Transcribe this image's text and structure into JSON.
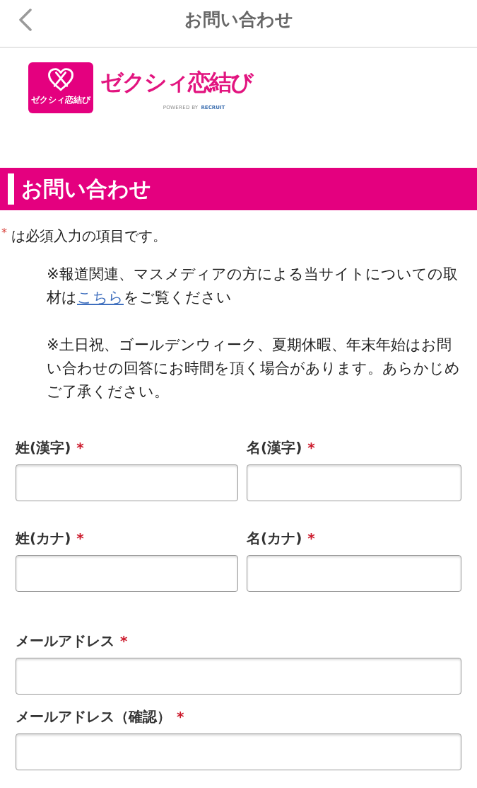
{
  "header": {
    "title": "お問い合わせ"
  },
  "logo": {
    "badge_text": "ゼクシィ恋結び",
    "name": "ゼクシィ恋結び",
    "tagline": "POWERED BY",
    "company": "RECRUIT"
  },
  "section": {
    "title": "お問い合わせ"
  },
  "required_note": {
    "mark": "*",
    "text": "は必須入力の項目です。"
  },
  "notes": [
    {
      "segments": [
        {
          "kind": "text",
          "text": "※報道関連、マスメディアの方による当サイトについての取材は"
        },
        {
          "kind": "link",
          "text": "こちら"
        },
        {
          "kind": "text",
          "text": "をご覧ください"
        }
      ]
    },
    {
      "segments": [
        {
          "kind": "text",
          "text": "※土日祝、ゴールデンウィーク、夏期休暇、年末年始はお問い合わせの回答にお時間を頂く場合があります。あらかじめご了承ください。"
        }
      ]
    }
  ],
  "name_rows": [
    {
      "fields": [
        {
          "label": "姓(漢字)",
          "required_mark": "*"
        },
        {
          "label": "名(漢字)",
          "required_mark": "*"
        }
      ]
    },
    {
      "fields": [
        {
          "label": "姓(カナ)",
          "required_mark": "*"
        },
        {
          "label": "名(カナ)",
          "required_mark": "*"
        }
      ]
    }
  ],
  "email_fields": [
    {
      "label": "メールアドレス",
      "required_mark": "*"
    },
    {
      "label": "メールアドレス（確認）",
      "required_mark": "*"
    }
  ]
}
